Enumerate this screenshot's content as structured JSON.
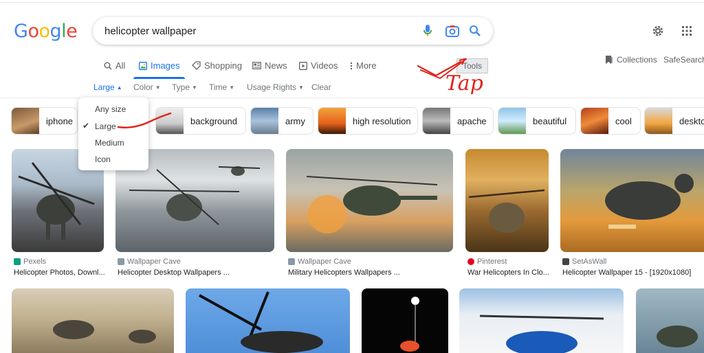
{
  "logo": "Google",
  "search": {
    "query": "helicopter wallpaper"
  },
  "tabs": [
    {
      "label": "All",
      "icon": "search-icon"
    },
    {
      "label": "Images",
      "icon": "image-icon"
    },
    {
      "label": "Shopping",
      "icon": "tag-icon"
    },
    {
      "label": "News",
      "icon": "news-icon"
    },
    {
      "label": "Videos",
      "icon": "play-icon"
    },
    {
      "label": "More",
      "icon": "more-vertical-icon"
    }
  ],
  "tools_label": "Tools",
  "collections_label": "Collections",
  "safesearch_label": "SafeSearch",
  "filters": {
    "size": "Large",
    "color": "Color",
    "type": "Type",
    "time": "Time",
    "usage": "Usage Rights",
    "clear": "Clear"
  },
  "size_menu": {
    "options": [
      "Any size",
      "Large",
      "Medium",
      "Icon"
    ],
    "selected": "Large"
  },
  "chips": [
    "iphone",
    "background",
    "army",
    "high resolution",
    "apache",
    "beautiful",
    "cool",
    "deskto"
  ],
  "annotation_text": "Tap",
  "results_row1": [
    {
      "source": "Pexels",
      "title": "Helicopter Photos, Downl..."
    },
    {
      "source": "Wallpaper Cave",
      "title": "Helicopter Desktop Wallpapers ..."
    },
    {
      "source": "Wallpaper Cave",
      "title": "Military Helicopters Wallpapers ..."
    },
    {
      "source": "Pinterest",
      "title": "War Helicopters In Clo..."
    },
    {
      "source": "SetAsWall",
      "title": "Helicopter Wallpaper 15 - [1920x1080]"
    }
  ],
  "colors": {
    "accent": "#1a73e8",
    "annotation": "#e0241b"
  }
}
